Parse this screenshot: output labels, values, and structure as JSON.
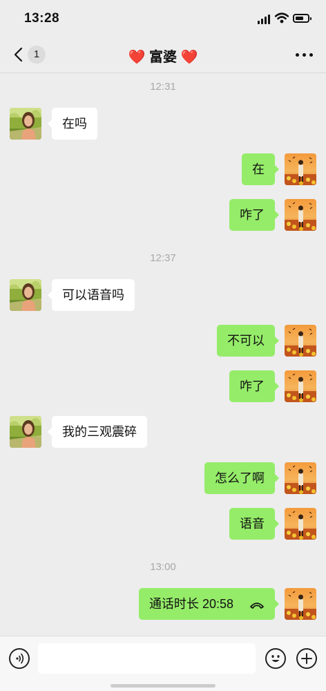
{
  "status_bar": {
    "time": "13:28"
  },
  "nav": {
    "unread_count": "1",
    "title_heart_left": "❤️",
    "title_name": "富婆",
    "title_heart_right": "❤️"
  },
  "messages": [
    {
      "kind": "timestamp",
      "text": "12:31"
    },
    {
      "kind": "incoming",
      "text": "在吗"
    },
    {
      "kind": "outgoing",
      "text": "在"
    },
    {
      "kind": "outgoing",
      "text": "咋了"
    },
    {
      "kind": "timestamp",
      "text": "12:37"
    },
    {
      "kind": "incoming",
      "text": "可以语音吗"
    },
    {
      "kind": "outgoing",
      "text": "不可以"
    },
    {
      "kind": "outgoing",
      "text": "咋了"
    },
    {
      "kind": "incoming",
      "text": "我的三观震碎"
    },
    {
      "kind": "outgoing",
      "text": "怎么了啊"
    },
    {
      "kind": "outgoing",
      "text": "语音"
    },
    {
      "kind": "timestamp",
      "text": "13:00"
    },
    {
      "kind": "outgoing-call",
      "text": "通话时长 20:58"
    }
  ],
  "input_bar": {
    "text_value": ""
  },
  "colors": {
    "outgoing_bubble": "#95ec69",
    "incoming_bubble": "#ffffff",
    "background": "#ededed",
    "timestamp_text": "#a8a8a8",
    "heart": "#e0251b"
  }
}
